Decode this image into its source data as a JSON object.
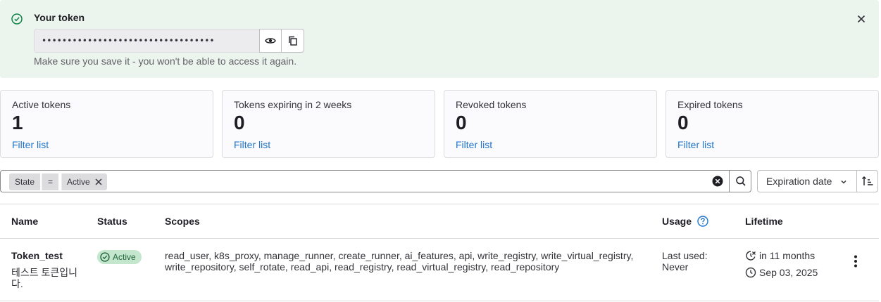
{
  "alert": {
    "title": "Your token",
    "token_masked": "••••••••••••••••••••••••••••••••••",
    "note": "Make sure you save it - you won't be able to access it again.",
    "icons": [
      "check-circle-icon",
      "eye-icon",
      "copy-icon",
      "close-icon"
    ]
  },
  "stats": [
    {
      "label": "Active tokens",
      "value": "1",
      "link": "Filter list"
    },
    {
      "label": "Tokens expiring in 2 weeks",
      "value": "0",
      "link": "Filter list"
    },
    {
      "label": "Revoked tokens",
      "value": "0",
      "link": "Filter list"
    },
    {
      "label": "Expired tokens",
      "value": "0",
      "link": "Filter list"
    }
  ],
  "filter": {
    "field": "State",
    "operator": "=",
    "value": "Active"
  },
  "sort": {
    "label": "Expiration date"
  },
  "table": {
    "headers": {
      "name": "Name",
      "status": "Status",
      "scopes": "Scopes",
      "usage": "Usage",
      "lifetime": "Lifetime"
    },
    "rows": [
      {
        "name": "Token_test",
        "description": "테스트 토큰입니다.",
        "status": "Active",
        "scopes": "read_user, k8s_proxy, manage_runner, create_runner, ai_features, api, write_registry, write_virtual_registry, write_repository, self_rotate, read_api, read_registry, read_virtual_registry, read_repository",
        "usage_label": "Last used:",
        "usage_value": "Never",
        "expires_in": "in 11 months",
        "expires_on": "Sep 03, 2025"
      }
    ]
  },
  "colors": {
    "alert_bg": "#ecf4ee",
    "success": "#108548",
    "link": "#1f75cb",
    "badge_bg": "#c3e6cd",
    "badge_text": "#24663b"
  }
}
